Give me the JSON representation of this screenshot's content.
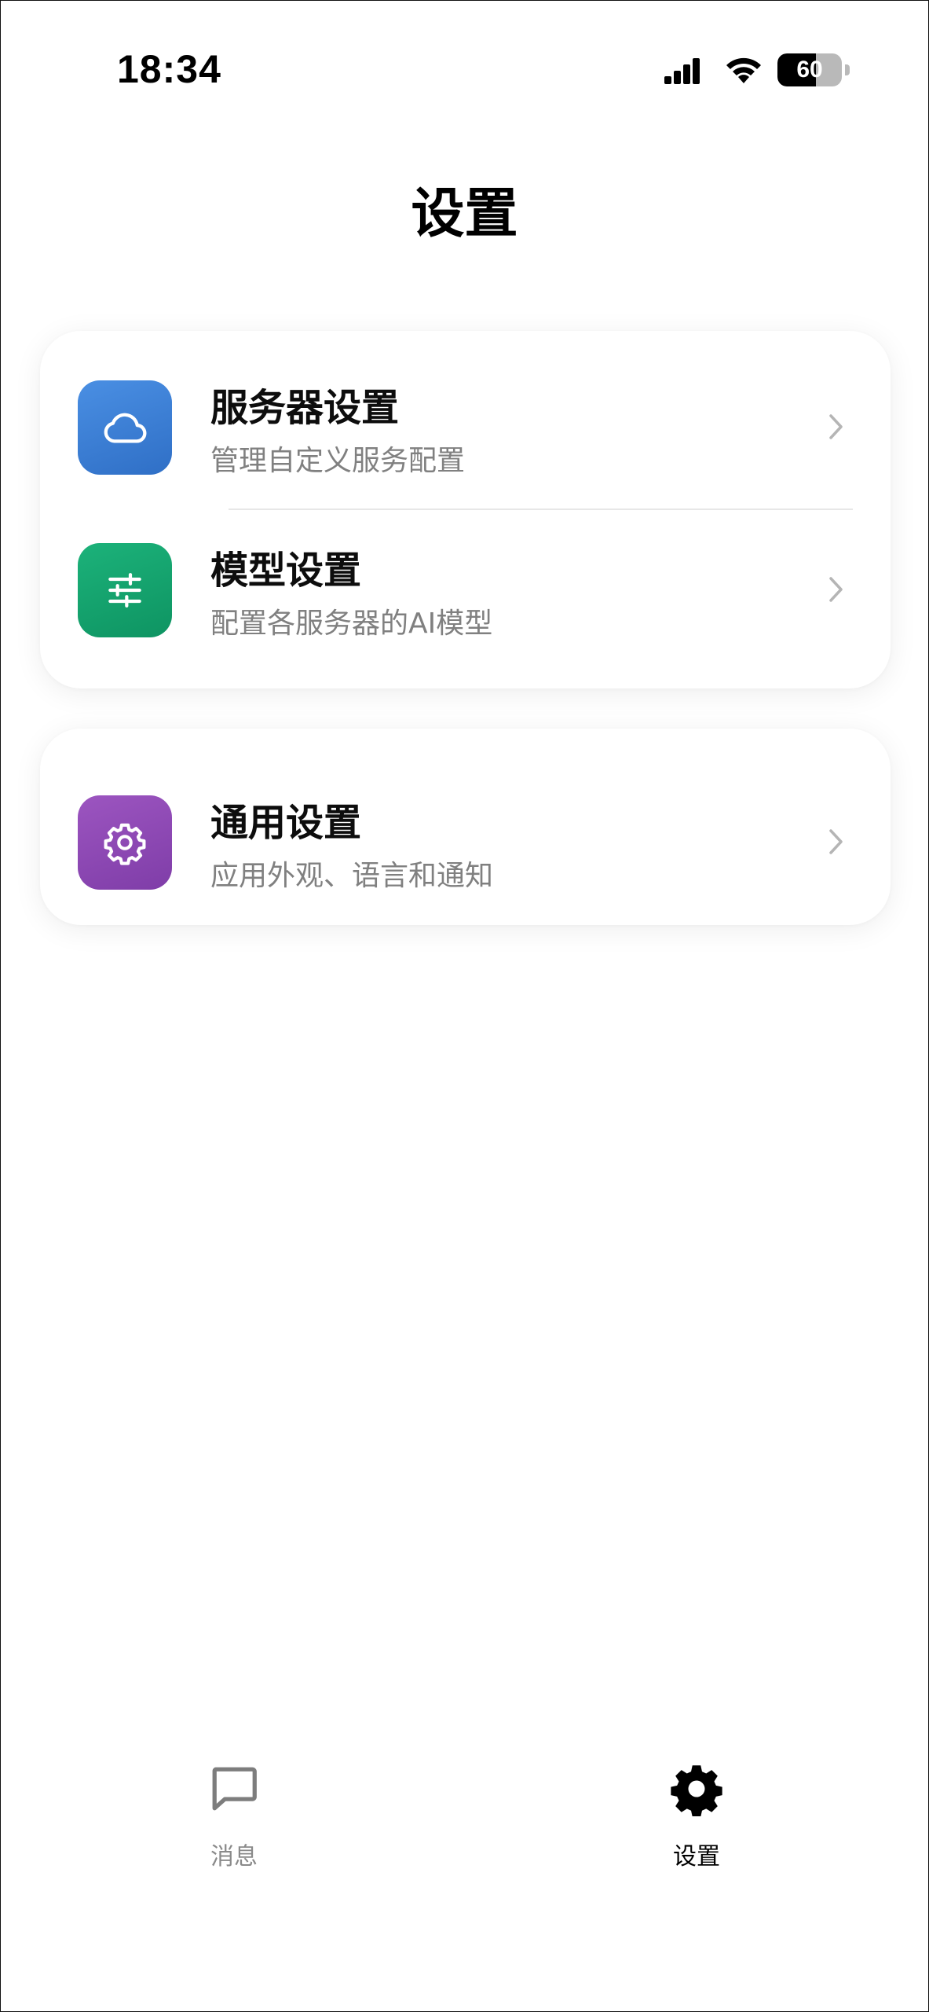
{
  "status_bar": {
    "time": "18:34",
    "battery_level": "60",
    "battery_fraction": 0.6
  },
  "header": {
    "title": "设置"
  },
  "settings": {
    "groups": [
      {
        "items": [
          {
            "title": "服务器设置",
            "subtitle": "管理自定义服务配置",
            "icon": "cloud-icon",
            "icon_color": "#3d7fd6"
          },
          {
            "title": "模型设置",
            "subtitle": "配置各服务器的AI模型",
            "icon": "sliders-icon",
            "icon_color": "#12a06a"
          }
        ]
      },
      {
        "items": [
          {
            "title": "通用设置",
            "subtitle": "应用外观、语言和通知",
            "icon": "gear-icon",
            "icon_color": "#8f4ab5"
          }
        ]
      }
    ]
  },
  "tabbar": {
    "tabs": [
      {
        "label": "消息",
        "icon": "chat-bubble-icon",
        "active": false
      },
      {
        "label": "设置",
        "icon": "gear-icon",
        "active": true
      }
    ]
  },
  "colors": {
    "active_tab": "#000000",
    "inactive_tab": "#8a8a8a",
    "subtitle": "#808080",
    "chevron": "#b5b5b5"
  }
}
